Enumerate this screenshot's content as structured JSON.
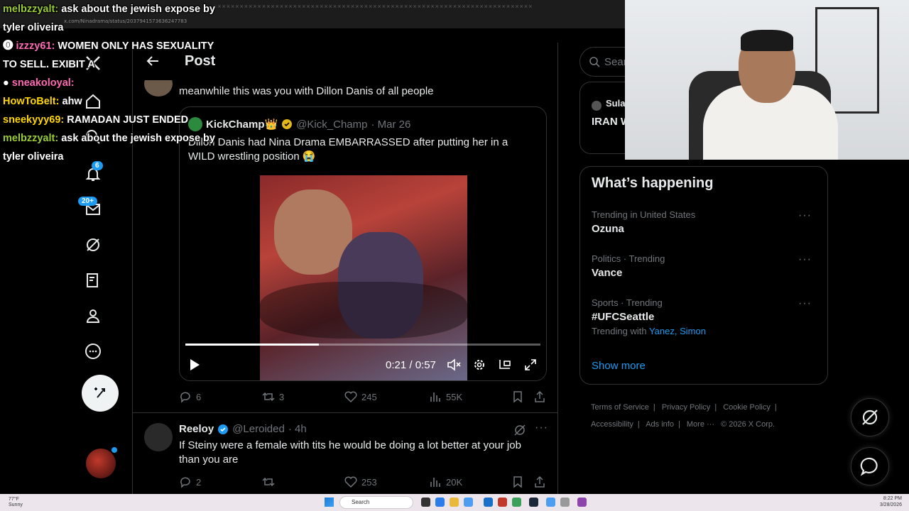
{
  "browser": {
    "url": "x.com/Ninadrama/status/2037941573636247783",
    "tab_markers": "××××××××××××××××××××××××××××××××××××××××××××××××××××××××××××××××××××××××"
  },
  "chat": [
    {
      "user": "melbzzyalt:",
      "message": "ask about the jewish expose by tyler oliveira",
      "color": "#9acd32"
    },
    {
      "user": "izzzy61:",
      "message": "WOMEN ONLY HAS SEXUALITY TO SELL. EXIBIT A",
      "color": "#ff69b4"
    },
    {
      "user": "sneakoloyal:",
      "message": "",
      "color": "#ff69b4"
    },
    {
      "user": "HowToBelt:",
      "message": "ahw",
      "color": "#ffd700"
    },
    {
      "user": "sneekyyy69:",
      "message": "RAMADAN JUST ENDED",
      "color": "#ffd700"
    },
    {
      "user": "melbzzyalt:",
      "message": "ask about the jewish expose by tyler oliveira",
      "color": "#9acd32"
    }
  ],
  "nav": {
    "notifications_badge": "6",
    "messages_badge": "20+"
  },
  "header": {
    "title": "Post"
  },
  "reply": {
    "text": "meanwhile this was you with Dillon Danis of all people"
  },
  "quote": {
    "name": "KickChamp👑",
    "handle": "@Kick_Champ",
    "date": "· Mar 26",
    "text": "Dillon Danis had Nina Drama EMBARRASSED after putting her in a WILD wrestling position 😭",
    "video": {
      "time": "0:21 / 0:57",
      "progress": 0.375
    }
  },
  "actions1": {
    "replies": "6",
    "reposts": "3",
    "likes": "245",
    "views": "55K"
  },
  "reply2": {
    "name": "Reeloy",
    "handle": "@Leroided",
    "time": "· 4h",
    "text": "If Steiny were a female with tits he would be doing a lot better at your job than you are"
  },
  "actions2": {
    "replies": "2",
    "reposts": "",
    "likes": "253",
    "views": "20K"
  },
  "right": {
    "search_placeholder": "Sear",
    "top_card": {
      "name": "Sula",
      "headline": "IRAN W GROU"
    },
    "happening_title": "What’s happening",
    "trends": [
      {
        "meta": "Trending in United States",
        "topic": "Ozuna"
      },
      {
        "meta": "Politics · Trending",
        "topic": "Vance"
      },
      {
        "meta": "Sports · Trending",
        "topic": "#UFCSeattle",
        "with_label": "Trending with",
        "with_links": "Yanez, Simon"
      }
    ],
    "show_more": "Show more",
    "footer": {
      "terms": "Terms of Service",
      "privacy": "Privacy Policy",
      "cookie": "Cookie Policy",
      "accessibility": "Accessibility",
      "ads": "Ads info",
      "more": "More ···",
      "copyright": "© 2026 X Corp."
    }
  },
  "taskbar": {
    "weather_temp": "77°F",
    "weather_desc": "Sunny",
    "search": "Search",
    "time": "8:22 PM",
    "date": "3/28/2026"
  },
  "colors": {
    "accent": "#1d9bf0",
    "background": "#000000",
    "muted": "#71767b",
    "border": "#2f3336"
  }
}
